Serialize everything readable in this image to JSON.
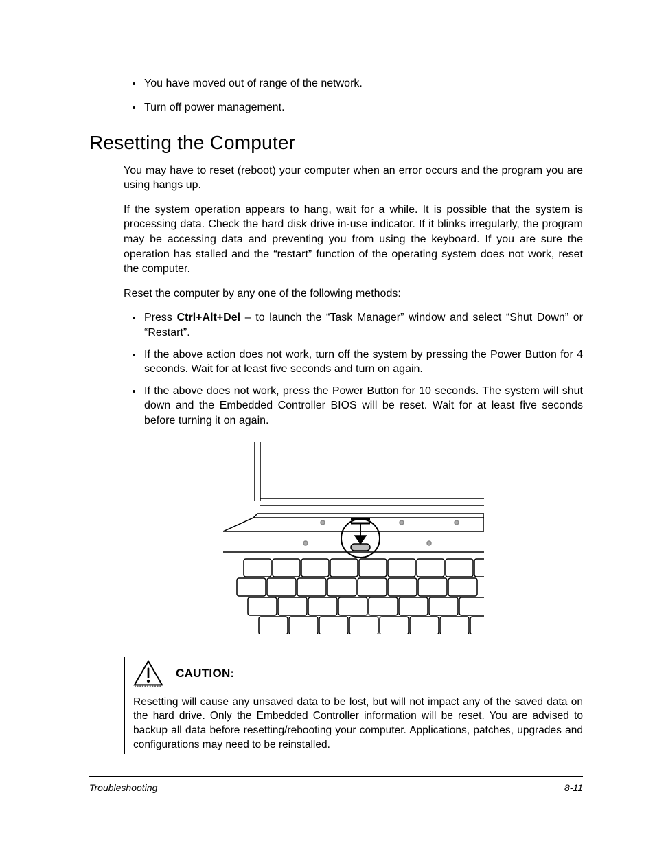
{
  "bullets_top": [
    "You have moved out of range of the network.",
    "Turn off power management."
  ],
  "heading": "Resetting the Computer",
  "para1": "You may have to reset (reboot) your computer when an error occurs and the program you are using hangs up.",
  "para2": "If the system operation appears to hang, wait for a while. It is possible that the system is processing data. Check the hard disk drive in-use indicator. If it blinks irregularly, the program may be accessing data and preventing you from using the keyboard. If you are sure the operation has stalled and the “restart” function of the operating system does not work, reset the computer.",
  "para3": "Reset the computer by any one of the following methods:",
  "method1_pre": "Press ",
  "method1_bold": "Ctrl+Alt+Del",
  "method1_post": " – to launch the “Task Manager” window and select “Shut Down” or “Restart”.",
  "method2": "If the above action does not work, turn off the system by pressing the Power Button for 4 seconds. Wait for at least five seconds and turn on again.",
  "method3": "If the above does not work, press the Power Button for 10 seconds. The system will shut down and the Embedded Controller BIOS will be reset. Wait for at least five seconds before turning it on again.",
  "caution_label": "CAUTION:",
  "caution_text": "Resetting will cause any unsaved data to be lost, but will not impact any of the saved data on the hard drive. Only the Embedded Controller information will be reset. You are advised to backup all data before resetting/rebooting your computer. Applications, patches, upgrades and configurations may need to be reinstalled.",
  "footer_left": "Troubleshooting",
  "footer_right": "8-11"
}
